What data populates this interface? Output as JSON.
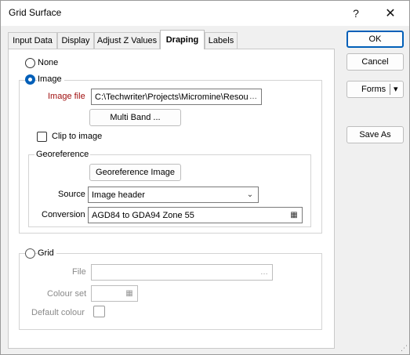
{
  "window": {
    "title": "Grid Surface",
    "help_glyph": "?",
    "close_glyph": "✕"
  },
  "tabs": [
    {
      "label": "Input Data"
    },
    {
      "label": "Display"
    },
    {
      "label": "Adjust Z Values"
    },
    {
      "label": "Draping",
      "active": true
    },
    {
      "label": "Labels"
    }
  ],
  "draping": {
    "none_label": "None",
    "image_label": "Image",
    "image_file_label": "Image file",
    "image_file_value": "C:\\Techwriter\\Projects\\Micromine\\Resou",
    "multiband_button": "Multi Band ...",
    "clip_label": "Clip to image",
    "georef_group_label": "Georeference",
    "georef_button": "Georeference Image",
    "source_label": "Source",
    "source_value": "Image header",
    "conversion_label": "Conversion",
    "conversion_value": "AGD84 to GDA94 Zone 55",
    "grid_label": "Grid",
    "file_label": "File",
    "file_value": "",
    "colour_set_label": "Colour set",
    "colour_set_value": "",
    "default_colour_label": "Default colour"
  },
  "side_buttons": {
    "ok": "OK",
    "cancel": "Cancel",
    "forms": "Forms",
    "forms_arrow": "▾",
    "save_as": "Save As"
  },
  "colors": {
    "accent": "#005fb8",
    "image_file_label": "#a01010"
  }
}
